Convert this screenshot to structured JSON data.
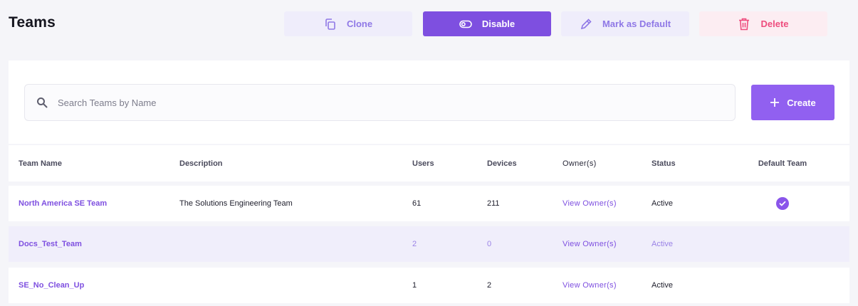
{
  "page": {
    "title": "Teams"
  },
  "toolbar": {
    "clone_label": "Clone",
    "disable_label": "Disable",
    "mark_default_label": "Mark as Default",
    "delete_label": "Delete"
  },
  "search": {
    "placeholder": "Search Teams by Name",
    "value": ""
  },
  "create_label": "Create",
  "table": {
    "columns": [
      "Team Name",
      "Description",
      "Users",
      "Devices",
      "Owner(s)",
      "Status",
      "Default Team"
    ],
    "rows": [
      {
        "name": "North America SE Team",
        "description": "The Solutions Engineering Team",
        "users": "61",
        "devices": "211",
        "owners": "View Owner(s)",
        "status": "Active",
        "default": true
      },
      {
        "name": "Docs_Test_Team",
        "description": "",
        "users": "2",
        "devices": "0",
        "owners": "View Owner(s)",
        "status": "Active",
        "default": false
      },
      {
        "name": "SE_No_Clean_Up",
        "description": "",
        "users": "1",
        "devices": "2",
        "owners": "View Owner(s)",
        "status": "Active",
        "default": false
      }
    ]
  },
  "colors": {
    "accent": "#7e4fe0",
    "create": "#9160f0",
    "delete": "#ee4d7e",
    "selected_row": "#f0eefb"
  },
  "icons": {
    "clone": "copy-icon",
    "disable": "toggle-icon",
    "mark_default": "pencil-icon",
    "delete": "trash-icon",
    "search": "search-icon",
    "create": "plus-icon",
    "default_team": "check-circle-icon"
  }
}
